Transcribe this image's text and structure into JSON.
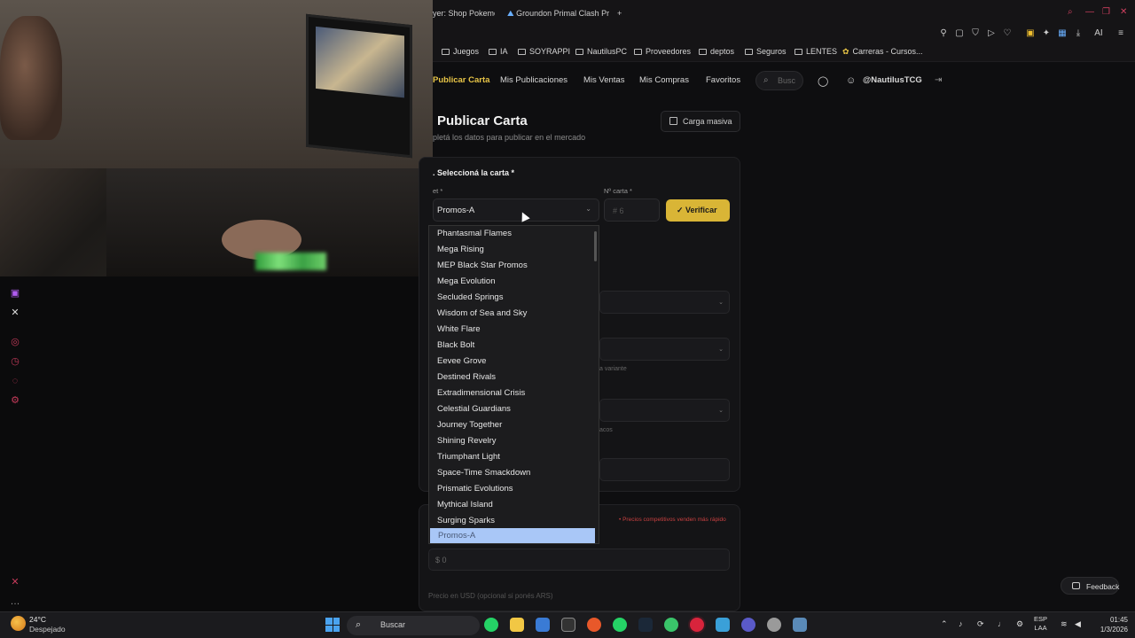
{
  "browser": {
    "tabs": [
      {
        "label": "yer: Shop Pokemon"
      },
      {
        "label": "Groundon Primal Clash Pr"
      }
    ],
    "new_tab_symbol": "+",
    "ai_label": "AI",
    "bookmarks": [
      {
        "label": "Juegos"
      },
      {
        "label": "IA"
      },
      {
        "label": "SOYRAPPI"
      },
      {
        "label": "NautilusPC"
      },
      {
        "label": "Proveedores"
      },
      {
        "label": "deptos"
      },
      {
        "label": "Seguros"
      },
      {
        "label": "LENTES"
      },
      {
        "label": "Carreras - Cursos..."
      }
    ]
  },
  "site": {
    "nav": {
      "items": [
        {
          "label": "Publicar Carta",
          "active": true
        },
        {
          "label": "Mis Publicaciones"
        },
        {
          "label": "Mis Ventas"
        },
        {
          "label": "Mis Compras"
        },
        {
          "label": "Favoritos"
        }
      ],
      "search_placeholder": "Busc",
      "username": "@NautilusTCG"
    },
    "page_title": "Publicar Carta",
    "page_subtitle": "pletá los datos para publicar en el mercado",
    "bulk_button": "Carga masiva",
    "section_label": ". Seleccioná la carta *",
    "set_label": "et *",
    "set_value": "Promos-A",
    "card_number_label": "Nº carta *",
    "card_number_placeholder": "# 6",
    "verify_button": "Verificar",
    "variant_note": "a variante",
    "other_note": "acos",
    "price_note": "• Precios competitivos venden más rápido",
    "price_placeholder": "$  0",
    "usd_label": "Precio en USD",
    "usd_hint": "(opcional si ponés ARS)",
    "feedback_button": "Feedback"
  },
  "dropdown": {
    "options": [
      {
        "label": "Phantasmal Flames"
      },
      {
        "label": "Mega Rising"
      },
      {
        "label": "MEP Black Star Promos"
      },
      {
        "label": "Mega Evolution"
      },
      {
        "label": "Secluded Springs"
      },
      {
        "label": "Wisdom of Sea and Sky"
      },
      {
        "label": "White Flare"
      },
      {
        "label": "Black Bolt"
      },
      {
        "label": "Eevee Grove"
      },
      {
        "label": "Destined Rivals"
      },
      {
        "label": "Extradimensional Crisis"
      },
      {
        "label": "Celestial Guardians"
      },
      {
        "label": "Journey Together"
      },
      {
        "label": "Shining Revelry"
      },
      {
        "label": "Triumphant Light"
      },
      {
        "label": "Space-Time Smackdown"
      },
      {
        "label": "Prismatic Evolutions"
      },
      {
        "label": "Mythical Island"
      },
      {
        "label": "Surging Sparks"
      },
      {
        "label": "Promos-A",
        "selected": true
      }
    ]
  },
  "taskbar": {
    "weather_temp": "24°C",
    "weather_desc": "Despejado",
    "search_label": "Buscar",
    "lang_top": "ESP",
    "lang_bottom": "LAA",
    "time": "01:45",
    "date": "1/3/2026"
  },
  "colors": {
    "accent": "#e8c547",
    "verify": "#d9b536",
    "selected_option": "#a9c7f7",
    "price_note": "#c84040"
  }
}
